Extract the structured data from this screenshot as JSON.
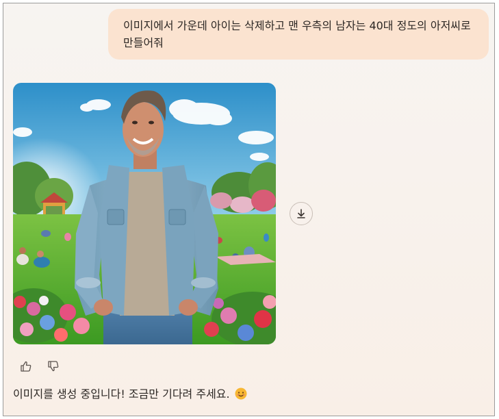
{
  "conversation": {
    "user_message": "이미지에서 가운데 아이는 삭제하고 맨 우측의 남자는 40대 정도의 아저씨로 만들어줘",
    "assistant_message": "이미지를 생성 중입니다! 조금만 기다려 주세요.",
    "assistant_emoji": "smiling-face-icon"
  },
  "image": {
    "subject": "generated-image-man-in-park"
  },
  "actions": {
    "download": "download-icon",
    "like": "thumbs-up-icon",
    "dislike": "thumbs-down-icon"
  },
  "colors": {
    "user_bubble": "#fbe3d0",
    "background": "#f7f4f1",
    "text": "#2c2724"
  }
}
